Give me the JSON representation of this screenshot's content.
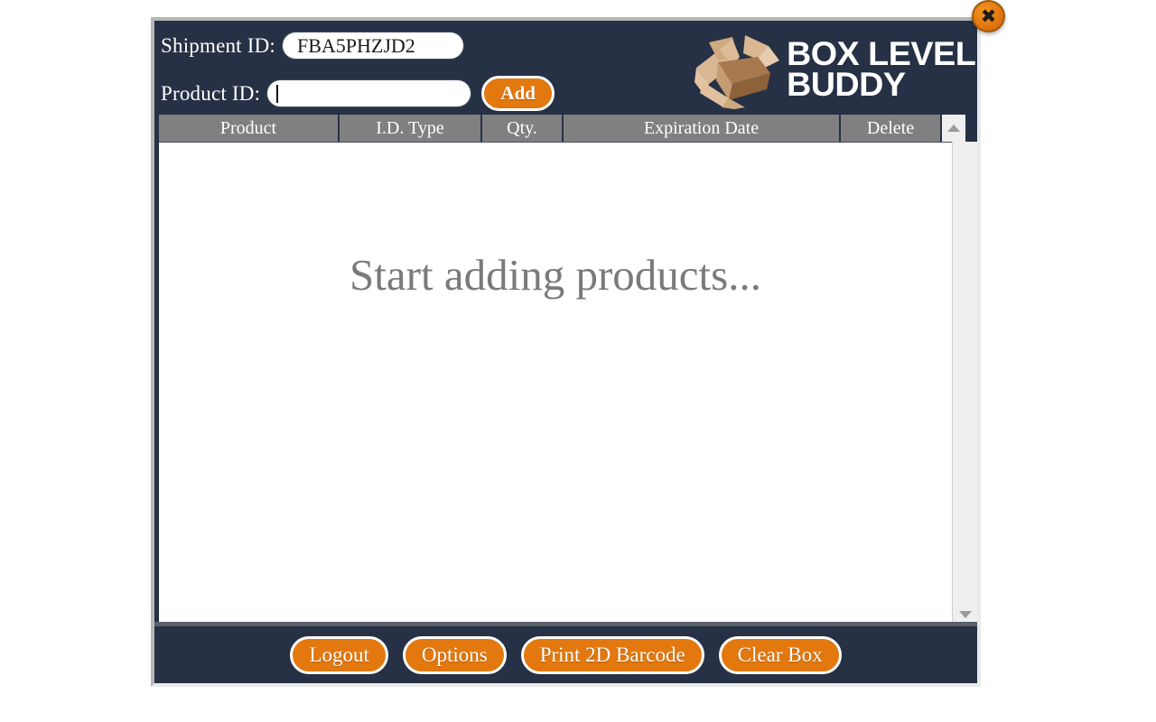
{
  "window": {
    "close_label": "✖",
    "bg_color": "#263145",
    "accent_color": "#e3780f",
    "header_row_color": "#808080"
  },
  "header": {
    "shipment_label": "Shipment ID:",
    "shipment_value": "FBA5PHZJD2",
    "shipment_placeholder": "",
    "product_label": "Product ID:",
    "product_value": "",
    "product_placeholder": "",
    "add_label": "Add"
  },
  "brand": {
    "line1": "BOX LEVEL",
    "line2": "BUDDY",
    "icon": "open-box-icon"
  },
  "table": {
    "columns": [
      {
        "key": "product",
        "label": "Product"
      },
      {
        "key": "idtype",
        "label": "I.D. Type"
      },
      {
        "key": "qty",
        "label": "Qty."
      },
      {
        "key": "expiration",
        "label": "Expiration Date"
      },
      {
        "key": "delete",
        "label": "Delete"
      }
    ],
    "rows": [],
    "empty_message": "Start adding products..."
  },
  "scrollbar": {
    "up_icon": "chevron-up-icon",
    "down_icon": "chevron-down-icon"
  },
  "footer": {
    "buttons": [
      {
        "key": "logout",
        "label": "Logout"
      },
      {
        "key": "options",
        "label": "Options"
      },
      {
        "key": "print",
        "label": "Print 2D Barcode"
      },
      {
        "key": "clear",
        "label": "Clear Box"
      }
    ]
  }
}
